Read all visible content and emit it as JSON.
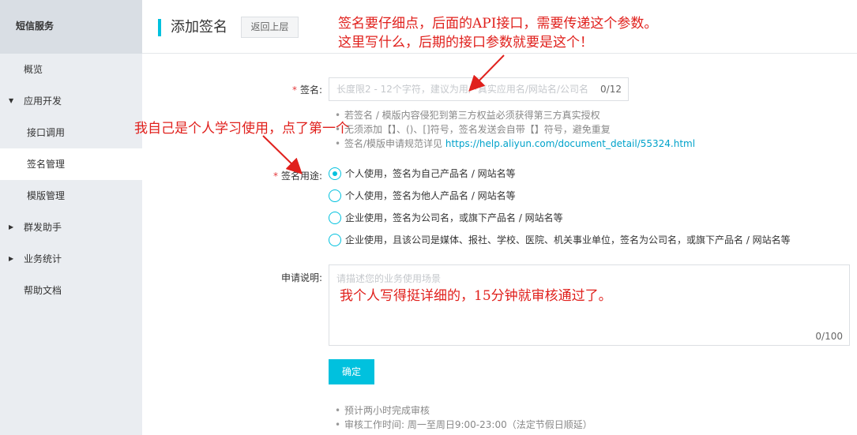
{
  "sidebar": {
    "header": "短信服务",
    "items": [
      {
        "label": "概览"
      },
      {
        "label": "应用开发"
      },
      {
        "label": "接口调用"
      },
      {
        "label": "签名管理"
      },
      {
        "label": "模版管理"
      },
      {
        "label": "群发助手"
      },
      {
        "label": "业务统计"
      },
      {
        "label": "帮助文档"
      }
    ]
  },
  "header": {
    "title": "添加签名",
    "back_label": "返回上层"
  },
  "form": {
    "signature": {
      "label": "签名:",
      "placeholder": "长度限2 - 12个字符，建议为用户真实应用名/网站名/公司名",
      "count": "0/12",
      "tips": [
        "若签名 / 模版内容侵犯到第三方权益必须获得第三方真实授权",
        "无须添加【】、()、[]符号，签名发送会自带【】符号，避免重复",
        "签名/模版申请规范详见 "
      ],
      "tips_link": "https://help.aliyun.com/document_detail/55324.html"
    },
    "usage": {
      "label": "签名用途:",
      "options": [
        "个人使用，签名为自己产品名 / 网站名等",
        "个人使用，签名为他人产品名 / 网站名等",
        "企业使用，签名为公司名，或旗下产品名 / 网站名等",
        "企业使用，且该公司是媒体、报社、学校、医院、机关事业单位，签名为公司名，或旗下产品名 / 网站名等"
      ],
      "selected_index": 0
    },
    "description": {
      "label": "申请说明:",
      "placeholder": "请描述您的业务使用场景",
      "count": "0/100"
    },
    "submit_label": "确定",
    "footer_tips": [
      "预计两小时完成审核",
      "审核工作时间: 周一至周日9:00-23:00（法定节假日顺延）"
    ]
  },
  "annotations": {
    "top_line1": "签名要仔细点，后面的API接口，需要传递这个参数。",
    "top_line2": "这里写什么，后期的接口参数就要是这个！",
    "usage_note": "我自己是个人学习使用，点了第一个",
    "desc_note": "我个人写得挺详细的，15分钟就审核通过了。"
  },
  "colors": {
    "accent": "#00c1de",
    "annotation": "#e0201c",
    "required": "#e4393c",
    "link": "#00a2ca"
  }
}
